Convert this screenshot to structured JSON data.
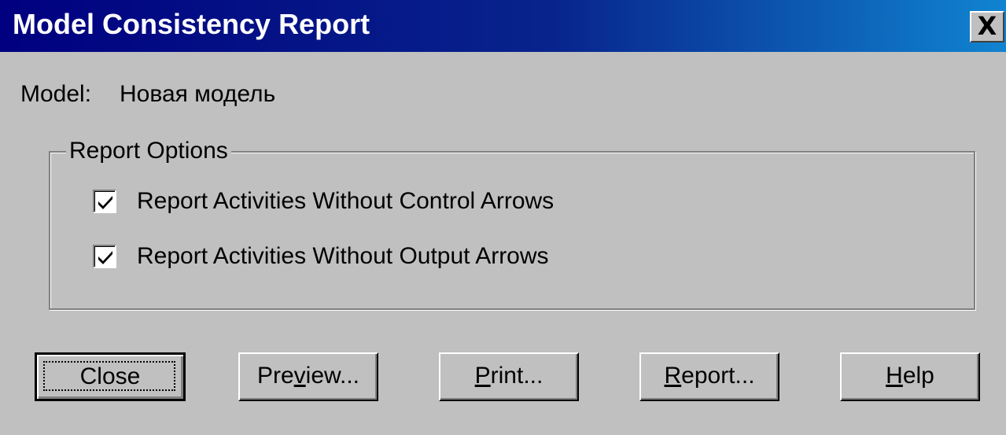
{
  "window": {
    "title": "Model Consistency Report",
    "close_glyph": "X"
  },
  "model": {
    "label": "Model:",
    "value": "Новая модель"
  },
  "report_options": {
    "legend": "Report Options",
    "options": [
      {
        "label": "Report Activities Without Control Arrows",
        "checked": true
      },
      {
        "label": "Report Activities Without Output Arrows",
        "checked": true
      }
    ]
  },
  "buttons": {
    "close": {
      "label": "Close"
    },
    "preview": {
      "pre": "Pre",
      "mnemonic": "v",
      "post": "iew..."
    },
    "print": {
      "pre": "",
      "mnemonic": "P",
      "post": "rint..."
    },
    "report": {
      "pre": "",
      "mnemonic": "R",
      "post": "eport..."
    },
    "help": {
      "pre": "",
      "mnemonic": "H",
      "post": "elp"
    }
  },
  "colors": {
    "dialog_face": "#c0c0c0",
    "titlebar_start": "#000080",
    "titlebar_end": "#1084d0",
    "title_text": "#ffffff"
  },
  "icons": {
    "window_close": "close-x-icon",
    "check": "checkmark-icon"
  }
}
